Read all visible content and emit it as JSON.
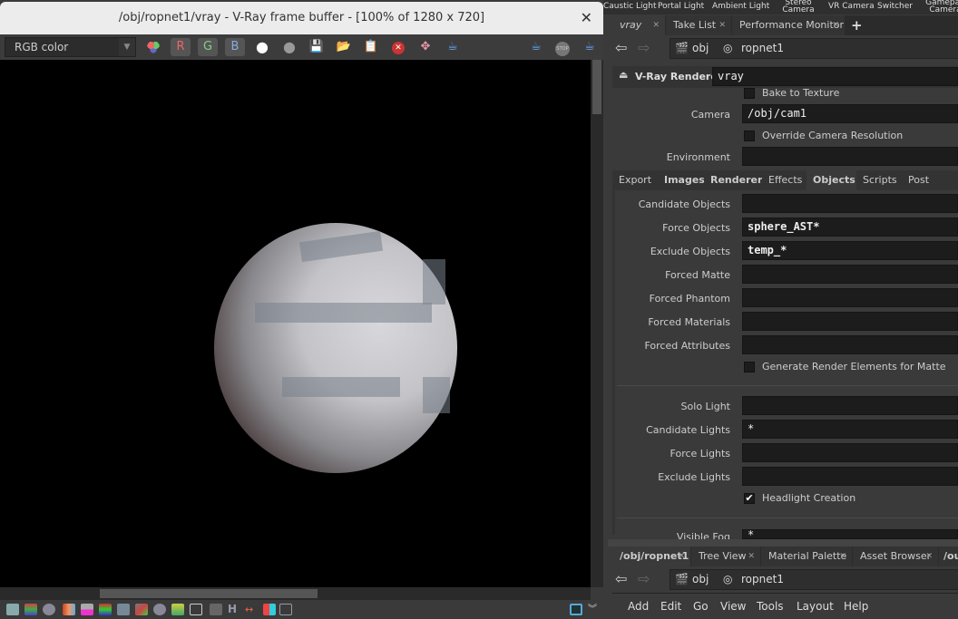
{
  "shelf": [
    "Caustic Light",
    "Portal Light",
    "Ambient Light",
    "Stereo Camera",
    "VR Camera",
    "Switcher",
    "Gamepad Camera"
  ],
  "framebuffer": {
    "title": "/obj/ropnet1/vray - V-Ray frame buffer - [100% of 1280 x 720]",
    "channel": "RGB color",
    "r": "R",
    "g": "G",
    "b": "B"
  },
  "params": {
    "top_tabs": [
      {
        "label": "vray"
      },
      {
        "label": "Take List"
      },
      {
        "label": "Performance Monitor"
      }
    ],
    "path": [
      "obj",
      "ropnet1"
    ],
    "node_type": "V-Ray Renderer",
    "node_name": "vray",
    "bake": "Bake to Texture",
    "camera_label": "Camera",
    "camera": "/obj/cam1",
    "override": "Override Camera Resolution",
    "environment_label": "Environment",
    "tabs": [
      "Export",
      "Images",
      "Renderer",
      "Effects",
      "Objects",
      "Scripts",
      "Post Transl"
    ],
    "active_tab": "Objects",
    "fields": [
      {
        "label": "Candidate Objects",
        "value": ""
      },
      {
        "label": "Force Objects",
        "value": "sphere_AST*"
      },
      {
        "label": "Exclude Objects",
        "value": "temp_*"
      },
      {
        "label": "Forced Matte",
        "value": ""
      },
      {
        "label": "Forced Phantom",
        "value": ""
      },
      {
        "label": "Forced Materials",
        "value": ""
      },
      {
        "label": "Forced Attributes",
        "value": ""
      }
    ],
    "gen_matte": "Generate Render Elements for Matte",
    "gen_matte_checked": false,
    "lights": [
      {
        "label": "Solo Light",
        "value": ""
      },
      {
        "label": "Candidate Lights",
        "value": "*"
      },
      {
        "label": "Force Lights",
        "value": ""
      },
      {
        "label": "Exclude Lights",
        "value": ""
      }
    ],
    "headlight": "Headlight Creation",
    "headlight_checked": true,
    "fog_label": "Visible Fog",
    "fog": "*"
  },
  "network": {
    "tabs": [
      "/obj/ropnet1",
      "Tree View",
      "Material Palette",
      "Asset Browser",
      "/ou"
    ],
    "path": [
      "obj",
      "ropnet1"
    ],
    "menu": [
      "Add",
      "Edit",
      "Go",
      "View",
      "Tools",
      "Layout",
      "Help"
    ]
  }
}
